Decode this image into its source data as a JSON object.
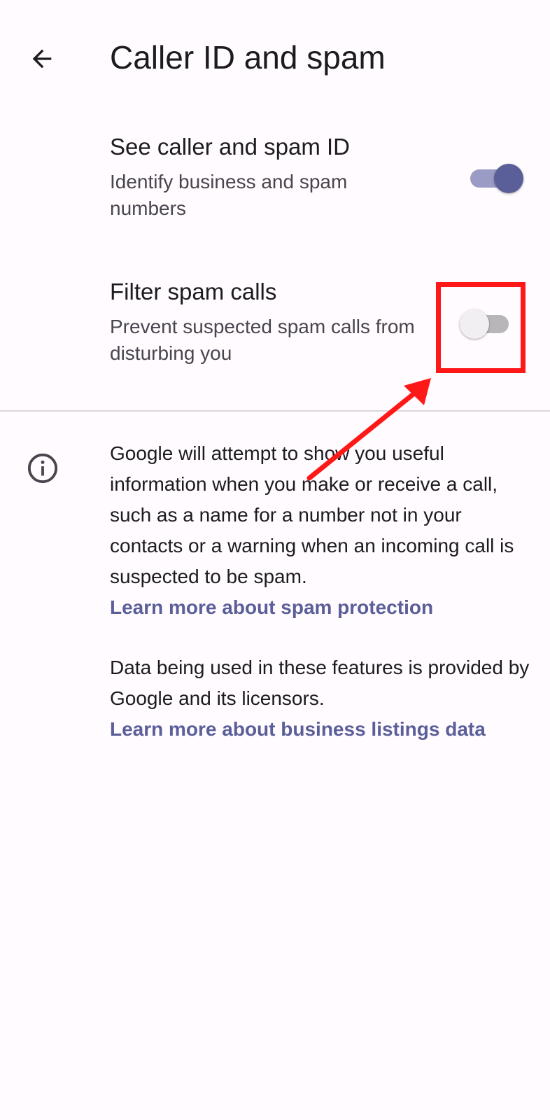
{
  "header": {
    "back_icon": "arrow-left-icon",
    "title": "Caller ID and spam"
  },
  "settings": [
    {
      "title": "See caller and spam ID",
      "summary": "Identify business and spam numbers",
      "enabled": true
    },
    {
      "title": "Filter spam calls",
      "summary": "Prevent suspected spam calls from disturbing you",
      "enabled": false
    }
  ],
  "info": {
    "icon": "info-icon",
    "paragraph1": "Google will attempt to show you useful information when you make or receive a call, such as a name for a number not in your contacts or a warning when an incoming call is suspected to be spam.",
    "link1": "Learn more about spam protection",
    "paragraph2": "Data being used in these features is provided by Google and its licensors.",
    "link2": "Learn more about business listings data"
  },
  "colors": {
    "background": "#fffbfe",
    "accent": "#5a5e99",
    "annotation": "#ff1818"
  }
}
